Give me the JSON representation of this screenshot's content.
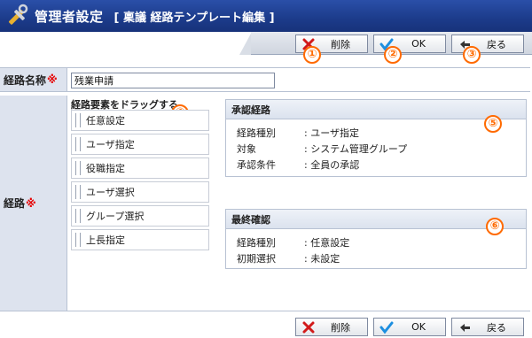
{
  "header": {
    "title": "管理者設定",
    "subtitle": "[ 稟議 経路テンプレート編集 ]"
  },
  "toolbar": {
    "delete_label": "削除",
    "ok_label": "OK",
    "back_label": "戻る"
  },
  "badges": [
    "①",
    "②",
    "③",
    "④",
    "⑤",
    "⑥"
  ],
  "form": {
    "name_label": "経路名称",
    "required_mark": "※",
    "name_value": "残業申請",
    "route_label": "経路"
  },
  "elements": {
    "title": "経路要素をドラッグする",
    "items": [
      "任意設定",
      "ユーザ指定",
      "役職指定",
      "ユーザ選択",
      "グループ選択",
      "上長指定"
    ]
  },
  "approval": {
    "title": "承認経路",
    "rows": [
      {
        "key": "経路種別",
        "value": ": ユーザ指定"
      },
      {
        "key": "対象",
        "value": ": システム管理グループ"
      },
      {
        "key": "承認条件",
        "value": ": 全員の承認"
      }
    ]
  },
  "final": {
    "title": "最終確認",
    "rows": [
      {
        "key": "経路種別",
        "value": ": 任意設定"
      },
      {
        "key": "初期選択",
        "value": ": 未設定"
      }
    ]
  },
  "colors": {
    "titlebar": "#1c3b8a",
    "badge": "#ff6a00",
    "required": "#e60000",
    "label_bg": "#dde3ee"
  },
  "icons": {
    "title": "tools-icon",
    "delete": "x-icon",
    "ok": "checkmark-icon",
    "back": "back-arrow-icon"
  }
}
